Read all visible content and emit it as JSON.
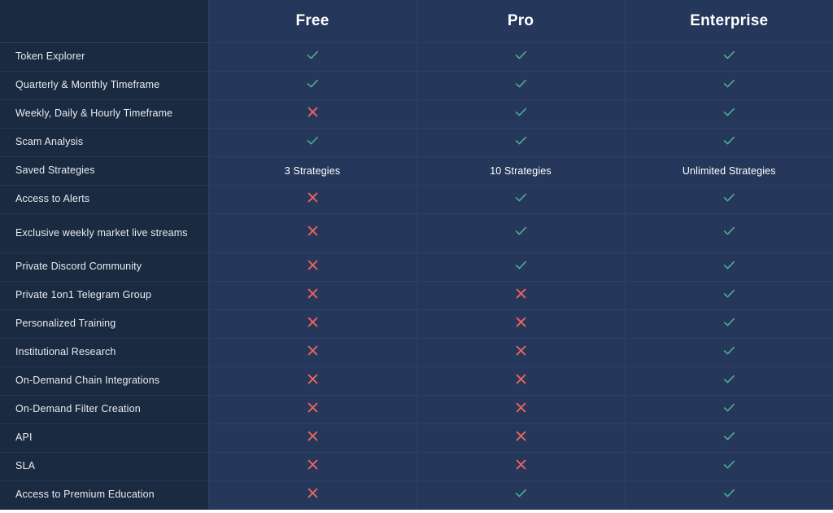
{
  "table": {
    "feature_column_header": "",
    "plans": [
      "Free",
      "Pro",
      "Enterprise"
    ],
    "colors": {
      "feature_column_bg": "#1a2a40",
      "plan_column_bg": "#25375a",
      "border": "#2e4164",
      "check": "#4caf92",
      "cross": "#e8645f",
      "text": "#e8ecf2",
      "header_text": "#ffffff"
    },
    "icons": {
      "check": "check-icon",
      "cross": "cross-icon"
    },
    "rows": [
      {
        "feature": "Token Explorer",
        "values": [
          "check",
          "check",
          "check"
        ]
      },
      {
        "feature": "Quarterly & Monthly Timeframe",
        "values": [
          "check",
          "check",
          "check"
        ]
      },
      {
        "feature": "Weekly, Daily & Hourly Timeframe",
        "values": [
          "cross",
          "check",
          "check"
        ]
      },
      {
        "feature": "Scam Analysis",
        "values": [
          "check",
          "check",
          "check"
        ]
      },
      {
        "feature": "Saved Strategies",
        "values": [
          "3 Strategies",
          "10 Strategies",
          "Unlimited Strategies"
        ],
        "value_type": "text"
      },
      {
        "feature": "Access to Alerts",
        "values": [
          "cross",
          "check",
          "check"
        ]
      },
      {
        "feature": "Exclusive weekly market live streams",
        "values": [
          "cross",
          "check",
          "check"
        ],
        "tall": true
      },
      {
        "feature": "Private Discord Community",
        "values": [
          "cross",
          "check",
          "check"
        ]
      },
      {
        "feature": "Private 1on1 Telegram Group",
        "values": [
          "cross",
          "cross",
          "check"
        ]
      },
      {
        "feature": "Personalized Training",
        "values": [
          "cross",
          "cross",
          "check"
        ]
      },
      {
        "feature": "Institutional Research",
        "values": [
          "cross",
          "cross",
          "check"
        ]
      },
      {
        "feature": "On-Demand Chain Integrations",
        "values": [
          "cross",
          "cross",
          "check"
        ]
      },
      {
        "feature": "On-Demand Filter Creation",
        "values": [
          "cross",
          "cross",
          "check"
        ]
      },
      {
        "feature": "API",
        "values": [
          "cross",
          "cross",
          "check"
        ]
      },
      {
        "feature": "SLA",
        "values": [
          "cross",
          "cross",
          "check"
        ]
      },
      {
        "feature": "Access to Premium Education",
        "values": [
          "cross",
          "check",
          "check"
        ]
      }
    ]
  }
}
